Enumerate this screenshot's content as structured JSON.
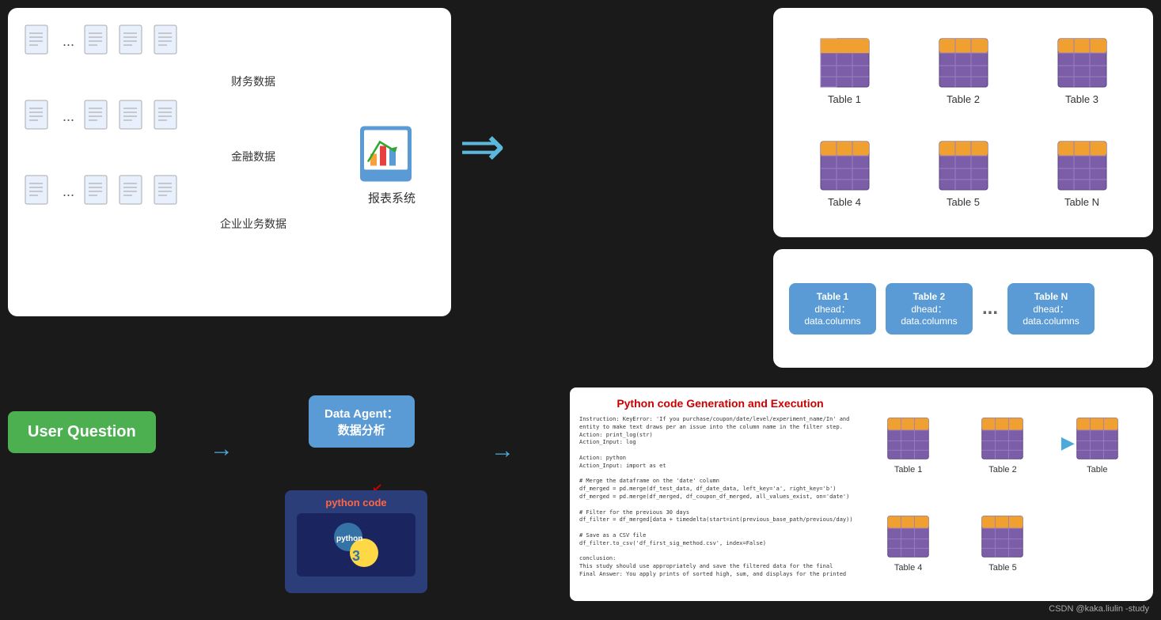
{
  "leftPanel": {
    "rows": [
      {
        "label": "财务数据"
      },
      {
        "label": "金融数据"
      },
      {
        "label": "企业业务数据"
      }
    ],
    "reportSystem": "报表系统"
  },
  "topRightPanel": {
    "tables": [
      "Table 1",
      "Table 2",
      "Table 3",
      "Table 4",
      "Table 5",
      "Table N"
    ]
  },
  "middlePanel": {
    "cards": [
      {
        "title": "Table 1",
        "subtitle": "dhead：\ndata.columns"
      },
      {
        "title": "Table 2",
        "subtitle": "dhead：\ndata.columns"
      },
      {
        "title": "Table N",
        "subtitle": "dhead：\ndata.columns"
      }
    ],
    "dots": "..."
  },
  "bottomLeft": {
    "userQuestion": "User Question",
    "dataAgent": "Data Agent：\n数据分析",
    "pythonCodeLabel": "python code"
  },
  "codePanel": {
    "title": "Python code Generation and\nExecution",
    "codeText": "Instruction: KeyError: 'If you purchase/coupon/date/level/experiment_name/In' and\nentity to make text draws per an issue into the column name in the filter step.\nAction: print_log(str)\nAction_Input: log\n\nAction: python\nAction_Input: import as et\n\n# Merge the dataframe on the 'date' column\ndf_merged = pd.merge(df_test_data, df_date_data, left_key='a', right_key='b')\ndf_merged = pd.merge(df_merged, df_coupon_df_merged, all_values_exist, on='date')\n\n# Filter for the previous 30 days\ndf_filter = df_merged[data + timedelta(start=int(previous_base_path/previous/day))\n\n# Save as a CSV file\ndf_filter.to_csv('df_first_sig_method.csv', index=False)\n\nconclusion:\nThis study should use appropriately and save the filtered data for the final\nFinal Answer: You apply prints of sorted high, sum, and displays for the printed"
  },
  "bottomRightPanel": {
    "tables": [
      "Table 1",
      "Table 2",
      "",
      "Table 4",
      "Table 5",
      "Table"
    ]
  },
  "watermark": "CSDN @kaka.liulin -study"
}
